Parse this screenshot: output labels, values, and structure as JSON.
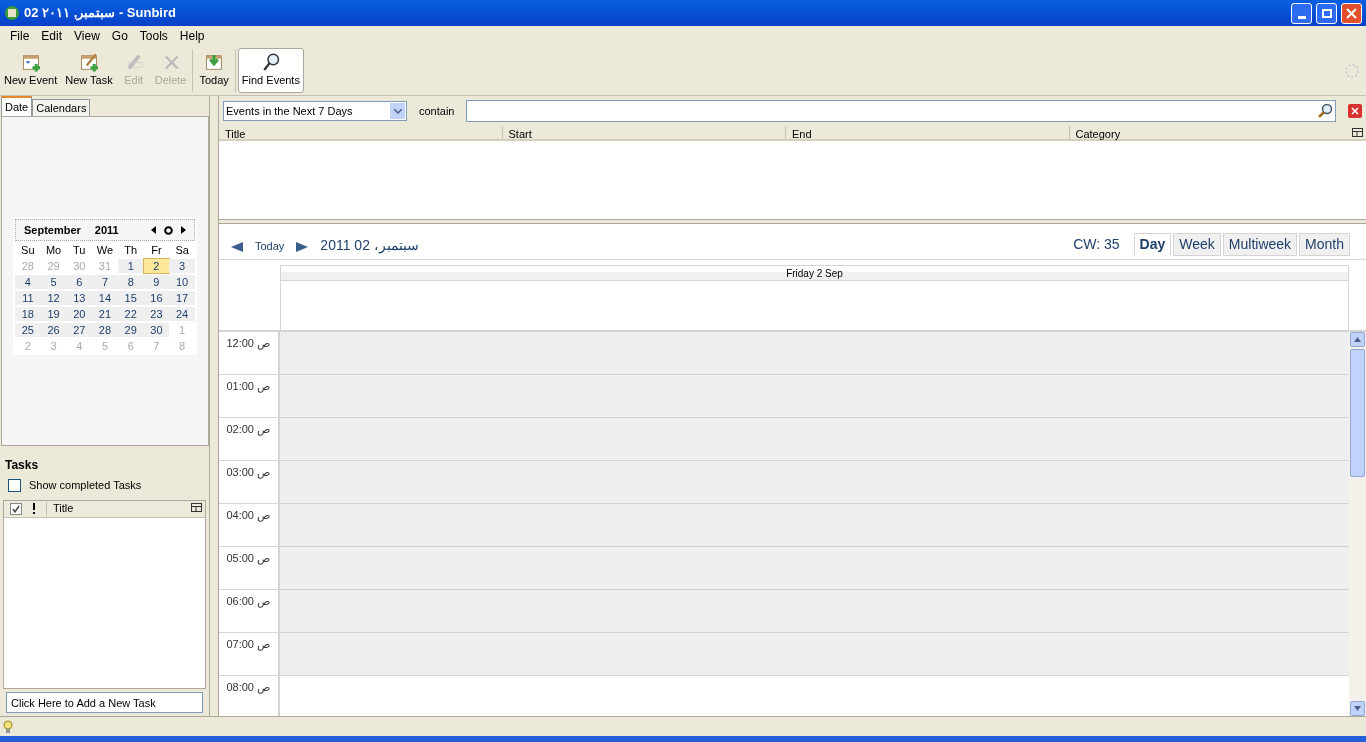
{
  "window": {
    "title": "02 سبتمبر, ٢٠١١ - Sunbird"
  },
  "menu": [
    "File",
    "Edit",
    "View",
    "Go",
    "Tools",
    "Help"
  ],
  "toolbar": [
    {
      "label": "New Event",
      "kind": "new-event",
      "disabled": false,
      "selected": false
    },
    {
      "label": "New Task",
      "kind": "new-task",
      "disabled": false,
      "selected": false
    },
    {
      "label": "Edit",
      "kind": "edit",
      "disabled": true,
      "selected": false
    },
    {
      "label": "Delete",
      "kind": "delete",
      "disabled": true,
      "selected": false
    },
    {
      "label": "Today",
      "kind": "today",
      "disabled": false,
      "selected": false
    },
    {
      "label": "Find Events",
      "kind": "find",
      "disabled": false,
      "selected": true
    }
  ],
  "side_tabs": [
    {
      "label": "Date",
      "selected": true
    },
    {
      "label": "Calendars",
      "selected": false
    }
  ],
  "minimonth": {
    "month": "September",
    "year": "2011",
    "weekdays": [
      "Su",
      "Mo",
      "Tu",
      "We",
      "Th",
      "Fr",
      "Sa"
    ],
    "weeks": [
      [
        {
          "d": "28",
          "other": true,
          "selected": false
        },
        {
          "d": "29",
          "other": true,
          "selected": false
        },
        {
          "d": "30",
          "other": true,
          "selected": false
        },
        {
          "d": "31",
          "other": true,
          "selected": false
        },
        {
          "d": "1",
          "other": false,
          "selected": false
        },
        {
          "d": "2",
          "other": false,
          "selected": true
        },
        {
          "d": "3",
          "other": false,
          "selected": false
        }
      ],
      [
        {
          "d": "4",
          "other": false,
          "selected": false
        },
        {
          "d": "5",
          "other": false,
          "selected": false
        },
        {
          "d": "6",
          "other": false,
          "selected": false
        },
        {
          "d": "7",
          "other": false,
          "selected": false
        },
        {
          "d": "8",
          "other": false,
          "selected": false
        },
        {
          "d": "9",
          "other": false,
          "selected": false
        },
        {
          "d": "10",
          "other": false,
          "selected": false
        }
      ],
      [
        {
          "d": "11",
          "other": false,
          "selected": false
        },
        {
          "d": "12",
          "other": false,
          "selected": false
        },
        {
          "d": "13",
          "other": false,
          "selected": false
        },
        {
          "d": "14",
          "other": false,
          "selected": false
        },
        {
          "d": "15",
          "other": false,
          "selected": false
        },
        {
          "d": "16",
          "other": false,
          "selected": false
        },
        {
          "d": "17",
          "other": false,
          "selected": false
        }
      ],
      [
        {
          "d": "18",
          "other": false,
          "selected": false
        },
        {
          "d": "19",
          "other": false,
          "selected": false
        },
        {
          "d": "20",
          "other": false,
          "selected": false
        },
        {
          "d": "21",
          "other": false,
          "selected": false
        },
        {
          "d": "22",
          "other": false,
          "selected": false
        },
        {
          "d": "23",
          "other": false,
          "selected": false
        },
        {
          "d": "24",
          "other": false,
          "selected": false
        }
      ],
      [
        {
          "d": "25",
          "other": false,
          "selected": false
        },
        {
          "d": "26",
          "other": false,
          "selected": false
        },
        {
          "d": "27",
          "other": false,
          "selected": false
        },
        {
          "d": "28",
          "other": false,
          "selected": false
        },
        {
          "d": "29",
          "other": false,
          "selected": false
        },
        {
          "d": "30",
          "other": false,
          "selected": false
        },
        {
          "d": "1",
          "other": true,
          "selected": false
        }
      ],
      [
        {
          "d": "2",
          "other": true,
          "selected": false
        },
        {
          "d": "3",
          "other": true,
          "selected": false
        },
        {
          "d": "4",
          "other": true,
          "selected": false
        },
        {
          "d": "5",
          "other": true,
          "selected": false
        },
        {
          "d": "6",
          "other": true,
          "selected": false
        },
        {
          "d": "7",
          "other": true,
          "selected": false
        },
        {
          "d": "8",
          "other": true,
          "selected": false
        }
      ]
    ]
  },
  "tasks": {
    "title": "Tasks",
    "show_completed": {
      "label": "Show completed Tasks",
      "checked": false
    },
    "columns": [
      "Title"
    ],
    "new_task_placeholder": "Click Here to Add a New Task"
  },
  "search": {
    "filter": "Events in the Next 7 Days",
    "contain_label": "contain"
  },
  "events_table": {
    "columns": [
      "Title",
      "Start",
      "End",
      "Category"
    ]
  },
  "day_view": {
    "today": "Today",
    "date": "سبتمبر، 02 2011",
    "week": "CW: 35",
    "views": [
      {
        "label": "Day",
        "selected": true
      },
      {
        "label": "Week",
        "selected": false
      },
      {
        "label": "Multiweek",
        "selected": false
      },
      {
        "label": "Month",
        "selected": false
      }
    ],
    "column_header": "Friday 2 Sep",
    "hours": [
      {
        "time": "12:00 ص",
        "shaded": true
      },
      {
        "time": "01:00 ص",
        "shaded": true
      },
      {
        "time": "02:00 ص",
        "shaded": true
      },
      {
        "time": "03:00 ص",
        "shaded": true
      },
      {
        "time": "04:00 ص",
        "shaded": true
      },
      {
        "time": "05:00 ص",
        "shaded": true
      },
      {
        "time": "06:00 ص",
        "shaded": true
      },
      {
        "time": "07:00 ص",
        "shaded": true
      },
      {
        "time": "08:00 ص",
        "shaded": false
      }
    ]
  }
}
